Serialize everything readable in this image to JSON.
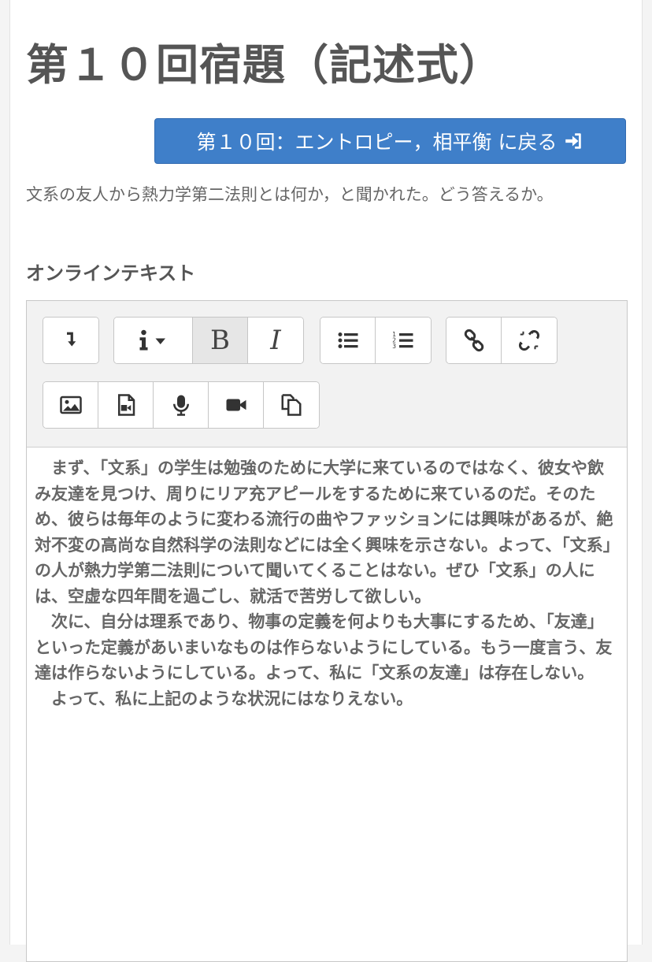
{
  "page": {
    "title": "第１０回宿題（記述式）",
    "back_button_label": "第１０回：エントロピー，相平衡 に戻る",
    "description": "文系の友人から熱力学第二法則とは何か，と聞かれた。どう答えるか。",
    "section_label": "オンラインテキスト"
  },
  "toolbar": {
    "buttons": [
      {
        "name": "collapse-toolbar",
        "icon": "arrow-down-right-icon"
      },
      {
        "name": "paragraph-style",
        "icon": "info-dropdown-icon"
      },
      {
        "name": "bold",
        "label": "B"
      },
      {
        "name": "italic",
        "label": "I"
      },
      {
        "name": "unordered-list",
        "icon": "bullet-list-icon"
      },
      {
        "name": "ordered-list",
        "icon": "numbered-list-icon"
      },
      {
        "name": "link",
        "icon": "link-icon"
      },
      {
        "name": "unlink",
        "icon": "unlink-icon"
      },
      {
        "name": "image",
        "icon": "image-icon"
      },
      {
        "name": "media",
        "icon": "media-file-icon"
      },
      {
        "name": "record-audio",
        "icon": "microphone-icon"
      },
      {
        "name": "record-video",
        "icon": "video-camera-icon"
      },
      {
        "name": "manage-files",
        "icon": "files-icon"
      }
    ]
  },
  "editor": {
    "paragraphs": [
      "まず、「文系」の学生は勉強のために大学に来ているのではなく、彼女や飲み友達を見つけ、周りにリア充アピールをするために来ているのだ。そのため、彼らは毎年のように変わる流行の曲やファッションには興味があるが、絶対不変の高尚な自然科学の法則などには全く興味を示さない。よって、「文系」の人が熱力学第二法則について聞いてくることはない。ぜひ「文系」の人には、空虚な四年間を過ごし、就活で苦労して欲しい。",
      "次に、自分は理系であり、物事の定義を何よりも大事にするため、「友達」といった定義があいまいなものは作らないようにしている。もう一度言う、友達は作らないようにしている。よって、私に「文系の友達」は存在しない。",
      "よって、私に上記のような状況にはなりえない。"
    ]
  },
  "colors": {
    "primary_button": "#3f7fc9",
    "title_text": "#555555",
    "body_text": "#666666"
  }
}
